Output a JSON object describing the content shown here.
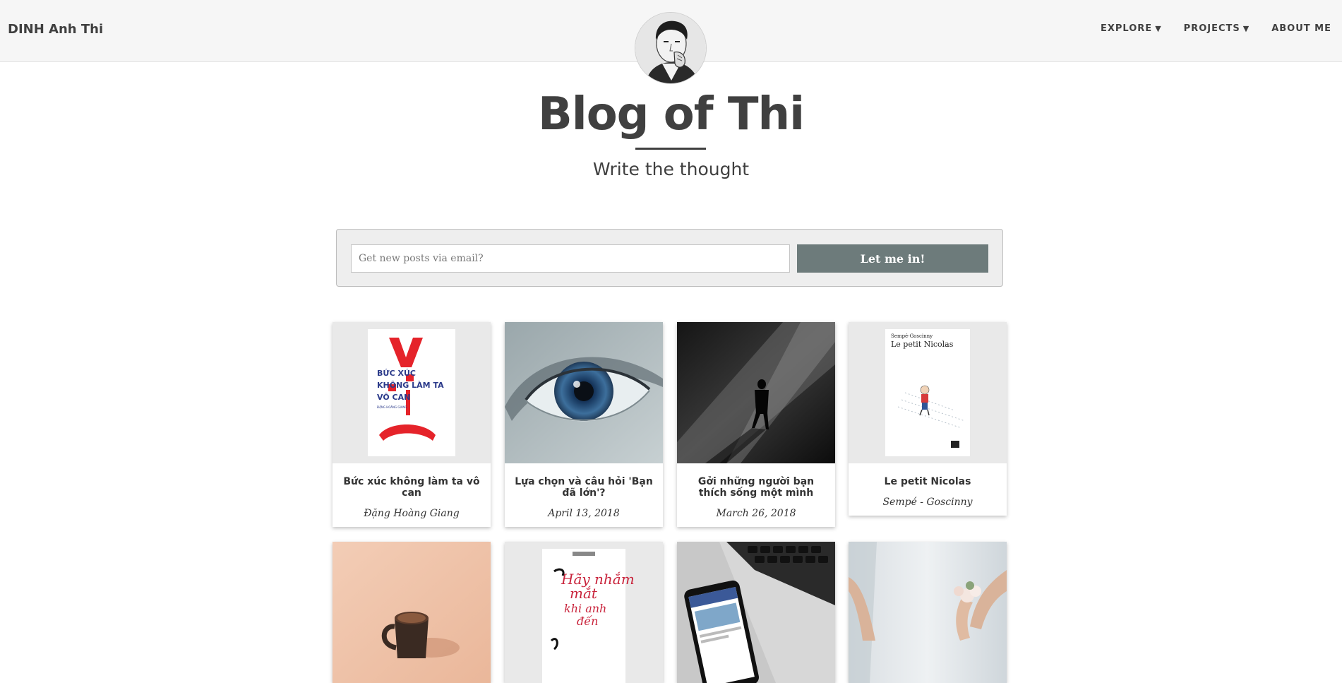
{
  "navbar": {
    "brand": "DINH Anh Thi",
    "links": [
      {
        "label": "EXPLORE",
        "caret": "▼"
      },
      {
        "label": "PROJECTS",
        "caret": "▼"
      },
      {
        "label": "ABOUT ME",
        "caret": ""
      }
    ]
  },
  "hero": {
    "title": "Blog of Thi",
    "subtitle": "Write the thought"
  },
  "subscribe": {
    "placeholder": "Get new posts via email?",
    "button_label": "Let me in!"
  },
  "posts": [
    {
      "title": "Bức xúc không làm ta vô can",
      "meta": "Đặng Hoàng Giang",
      "cover_lines": [
        "BỨC XÚC",
        "KHÔNG LÀM TA",
        "VÔ CAN"
      ],
      "cover_author": "ĐẶNG HOÀNG GIANG"
    },
    {
      "title": "Lựa chọn và câu hỏi 'Bạn đã lớn'?",
      "meta": "April 13, 2018"
    },
    {
      "title": "Gởi những người bạn thích sống một mình",
      "meta": "March 26, 2018"
    },
    {
      "title": "Le petit Nicolas",
      "meta": "Sempé - Goscinny",
      "cover_author": "Sempé-Goscinny",
      "cover_title": "Le petit Nicolas"
    },
    {
      "title": "",
      "meta": ""
    },
    {
      "title": "",
      "meta": "",
      "cover_lines": [
        "Hãy nhắm",
        "mắt",
        "khi anh",
        "đến"
      ]
    },
    {
      "title": "",
      "meta": ""
    },
    {
      "title": "",
      "meta": ""
    }
  ],
  "colors": {
    "navbar_bg": "#f6f6f6",
    "button_bg": "#6d7b7b",
    "text": "#404040"
  }
}
